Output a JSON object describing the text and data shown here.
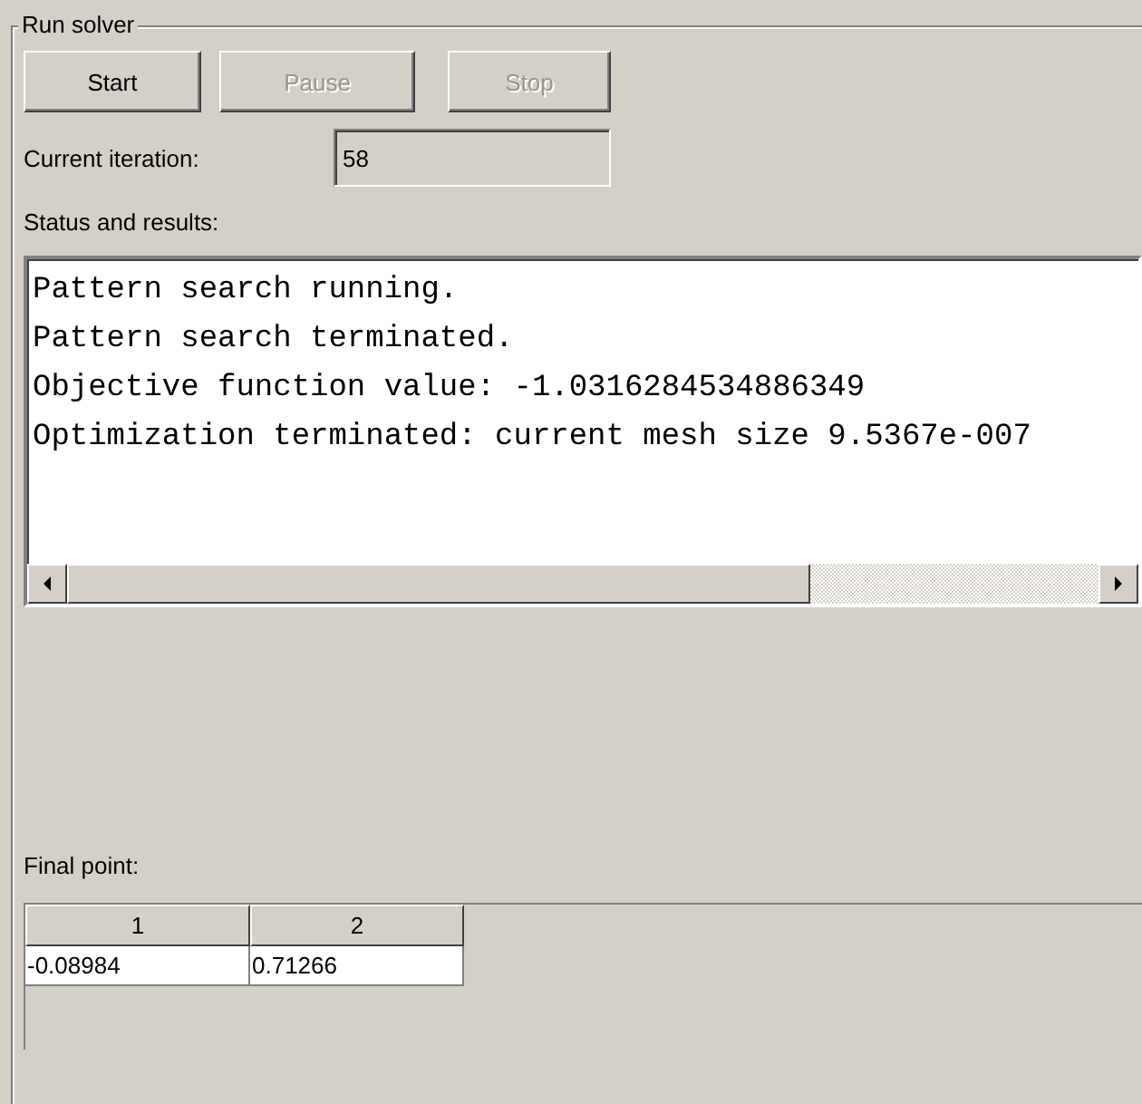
{
  "panel": {
    "title": "Run solver"
  },
  "buttons": [
    {
      "label": "Start",
      "disabled": false
    },
    {
      "label": "Pause",
      "disabled": true
    },
    {
      "label": "Stop",
      "disabled": true
    }
  ],
  "current_iteration": {
    "label": "Current iteration:",
    "value": "58"
  },
  "status": {
    "label": "Status and results:",
    "lines": [
      "Pattern search running.",
      "Pattern search terminated.",
      "Objective function value: -1.0316284534886349",
      "Optimization terminated: current mesh size 9.5367e-007"
    ]
  },
  "final_point": {
    "label": "Final point:",
    "columns": [
      "1",
      "2"
    ],
    "rows": [
      [
        "-0.08984",
        "0.71266"
      ]
    ]
  }
}
